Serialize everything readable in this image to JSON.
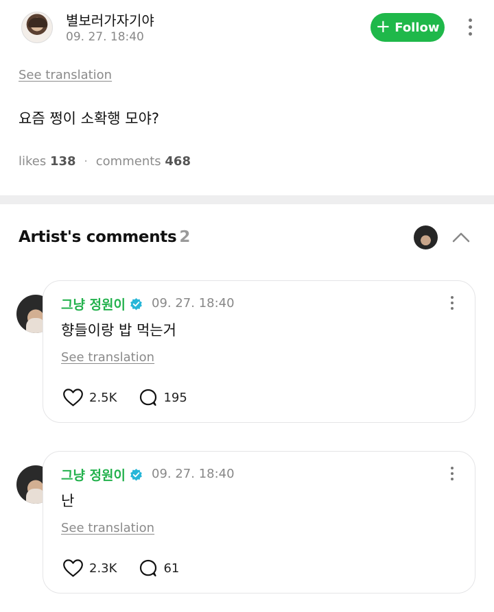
{
  "post": {
    "username": "별보러가자기야",
    "date": "09. 27. 18:40",
    "follow_label": "Follow",
    "see_translation": "See translation",
    "text": "요즘 쩡이 소확행 모야?",
    "likes_label": "likes",
    "likes_count": "138",
    "separator": "·",
    "comments_label": "comments",
    "comments_count": "468"
  },
  "artist_comments": {
    "title": "Artist's comments",
    "count": "2",
    "items": [
      {
        "name": "그냥 정원이",
        "date": "09. 27. 18:40",
        "text": "향들이랑 밥 먹는거",
        "see_translation": "See translation",
        "likes": "2.5K",
        "replies": "195"
      },
      {
        "name": "그냥 정원이",
        "date": "09. 27. 18:40",
        "text": "난",
        "see_translation": "See translation",
        "likes": "2.3K",
        "replies": "61"
      }
    ]
  },
  "icons": {
    "follow": "plus-icon",
    "more": "more-vertical-icon",
    "collapse": "chevron-up-icon",
    "verified": "verified-badge-icon",
    "like": "heart-icon",
    "reply": "speech-bubble-icon"
  },
  "colors": {
    "accent_green": "#1fb84a",
    "artist_name_green": "#22b14c",
    "verified_blue": "#27b6d8"
  }
}
